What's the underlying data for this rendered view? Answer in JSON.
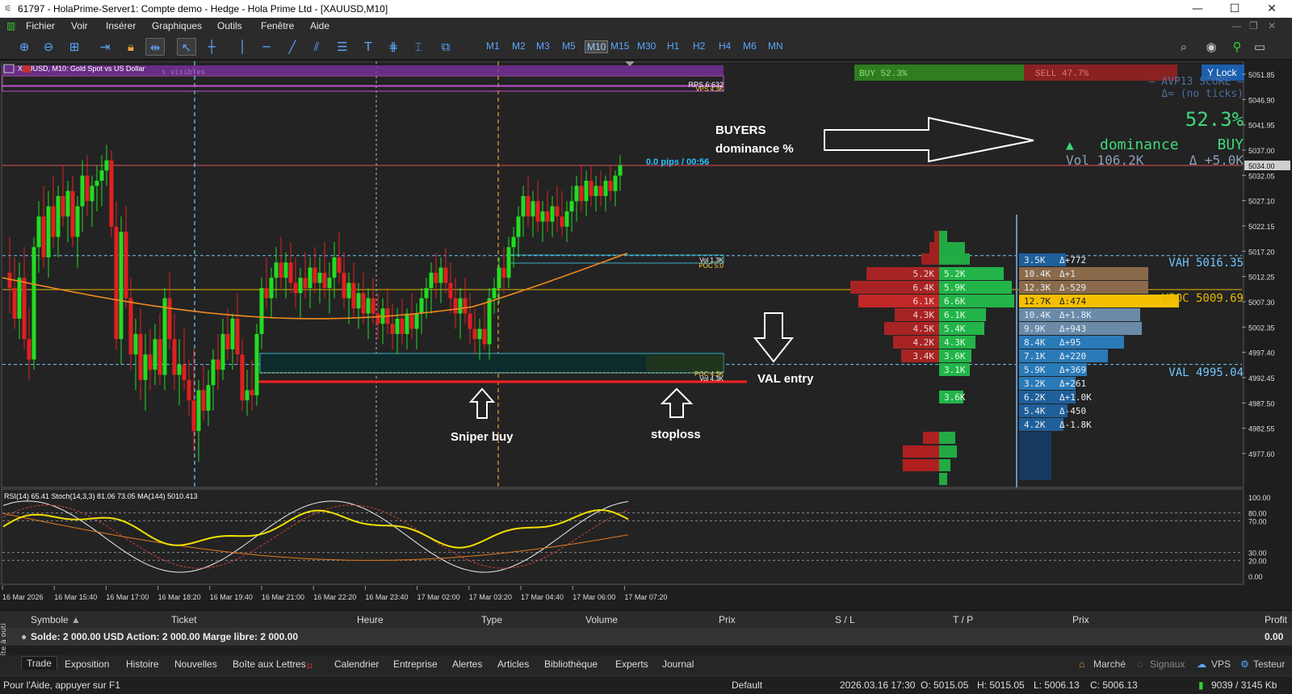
{
  "window": {
    "title": "61797 - HolaPrime-Server1: Compte demo - Hedge - Hola Prime Ltd - [XAUUSD,M10]",
    "minimize": "—",
    "maximize": "☐",
    "close": "✕"
  },
  "menu": [
    "Fichier",
    "Voir",
    "Insérer",
    "Graphiques",
    "Outils",
    "Fenêtre",
    "Aide"
  ],
  "timeframes": [
    "M1",
    "M2",
    "M3",
    "M5",
    "M10",
    "M15",
    "M30",
    "H1",
    "H2",
    "H4",
    "M6",
    "MN"
  ],
  "selected_timeframe": "M10",
  "chart": {
    "symbol_title": "XAUUSD, M10:  Gold Spot vs US Dollar",
    "symbol_overlay": "s visibles",
    "rps_label": "RPS 6:632",
    "vps_label": "VPS 4:3K",
    "pips_label": "0.0 pips / 00:56",
    "vol_top_1": "Vol 1.3K",
    "poc_top_1": "POC 5:0",
    "poc_bottom": "POC 4.3K",
    "vol_bottom": "Vol 4.3K",
    "buy_bar_label": "BUY  52.3%",
    "sell_bar_label": "SELL  47.7%",
    "ylock_label": "Y Lock",
    "avp_title": "— AVP13  SCORE —",
    "avp_sub": "Δ≈ (no ticks)",
    "score_pct": "52.3%",
    "dominance_arrow": "▲",
    "dominance_label": "dominance",
    "dominance_side": "BUY",
    "vol_summary": "Vol 106.2K",
    "delta_summary": "Δ +5.0K",
    "vah_label": "VAH 5016.35",
    "vpoc_label": "VPOC 5009.69",
    "val_label": "VAL 4995.04",
    "current_price": "5034.00",
    "price_axis": [
      "5051.85",
      "5046.90",
      "5041.95",
      "5037.00",
      "5032.05",
      "5027.10",
      "5022.15",
      "5017.20",
      "5012.25",
      "5007.30",
      "5002.35",
      "4997.40",
      "4992.45",
      "4987.50",
      "4982.55",
      "4977.60"
    ],
    "time_axis": [
      "16 Mar 2026",
      "16 Mar 15:40",
      "16 Mar 17:00",
      "16 Mar 18:20",
      "16 Mar 19:40",
      "16 Mar 21:00",
      "16 Mar 22:20",
      "16 Mar 23:40",
      "17 Mar 02:00",
      "17 Mar 03:20",
      "17 Mar 04:40",
      "17 Mar 06:00",
      "17 Mar 07:20"
    ],
    "indicator_title": "RSI(14) 65.41 Stoch(14,3,3) 81.06 73.05 MA(144) 5010.413",
    "indicator_axis": [
      "100.00",
      "80.00",
      "70.00",
      "30.00",
      "20.00",
      "0.00"
    ],
    "annotations": {
      "buyers": "BUYERS",
      "dominance_pct": "dominance %",
      "val_entry": "VAL entry",
      "sniper": "Sniper buy",
      "stoploss": "stoploss"
    },
    "profile_rows": [
      {
        "sell": "5.2K",
        "buy": "5.2K",
        "vol": "10.4K",
        "delta": "Δ+1"
      },
      {
        "sell": "6.4K",
        "buy": "5.9K",
        "vol": "12.3K",
        "delta": "Δ-529"
      },
      {
        "sell": "6.1K",
        "buy": "6.6K",
        "vol": "12.7K",
        "delta": "Δ:474"
      },
      {
        "sell": "4.3K",
        "buy": "6.1K",
        "vol": "10.4K",
        "delta": "Δ+1.8K"
      },
      {
        "sell": "4.5K",
        "buy": "5.4K",
        "vol": "9.9K",
        "delta": "Δ+943"
      },
      {
        "sell": "4.2K",
        "buy": "4.3K",
        "vol": "8.4K",
        "delta": "Δ+95"
      },
      {
        "sell": "3.4K",
        "buy": "3.6K",
        "vol": "7.1K",
        "delta": "Δ+220"
      },
      {
        "sell": "",
        "buy": "3.1K",
        "vol": "5.9K",
        "delta": "Δ+369"
      },
      {
        "sell": "",
        "buy": "",
        "vol": "3.2K",
        "delta": "Δ+261"
      },
      {
        "sell": "",
        "buy": "3.6K",
        "vol": "6.2K",
        "delta": "Δ+1.0K"
      },
      {
        "sell": "",
        "buy": "",
        "vol": "5.4K",
        "delta": "Δ-450"
      },
      {
        "sell": "",
        "buy": "",
        "vol": "4.2K",
        "delta": "Δ-1.8K"
      }
    ],
    "profile_top": {
      "vol": "3.5K",
      "delta": "Δ+772"
    }
  },
  "toolbox_headers": {
    "symbol": "Symbole",
    "ticket": "Ticket",
    "time": "Heure",
    "type": "Type",
    "volume": "Volume",
    "price": "Prix",
    "sl": "S / L",
    "tp": "T / P",
    "price2": "Prix",
    "profit": "Profit"
  },
  "balance_text": "Solde: 2 000.00 USD  Action: 2 000.00  Marge libre: 2 000.00",
  "balance_profit": "0.00",
  "side_label": "Boîte à outi",
  "tabs": [
    "Trade",
    "Exposition",
    "Histoire",
    "Nouvelles",
    "Boîte aux Lettres",
    "Calendrier",
    "Entreprise",
    "Alertes",
    "Articles",
    "Bibliothèque",
    "Experts",
    "Journal"
  ],
  "mail_badge": "11",
  "right_tabs": [
    "Marché",
    "Signaux",
    "VPS",
    "Testeur"
  ],
  "status": {
    "help": "Pour l'Aide, appuyer sur F1",
    "profile": "Default",
    "datetime": "2026.03.16 17:30",
    "open": "O: 5015.05",
    "high": "H: 5015.05",
    "low": "L: 5006.13",
    "close": "C: 5006.13",
    "traffic": "9039 / 3145 Kb"
  },
  "colors": {
    "bull": "#22dd22",
    "bear": "#e02020",
    "bg": "#232323",
    "vah_line": "#6fc6ff",
    "vpoc_line": "#e6b800",
    "ma": "#f08a1e",
    "score_green": "#3fd97a"
  }
}
